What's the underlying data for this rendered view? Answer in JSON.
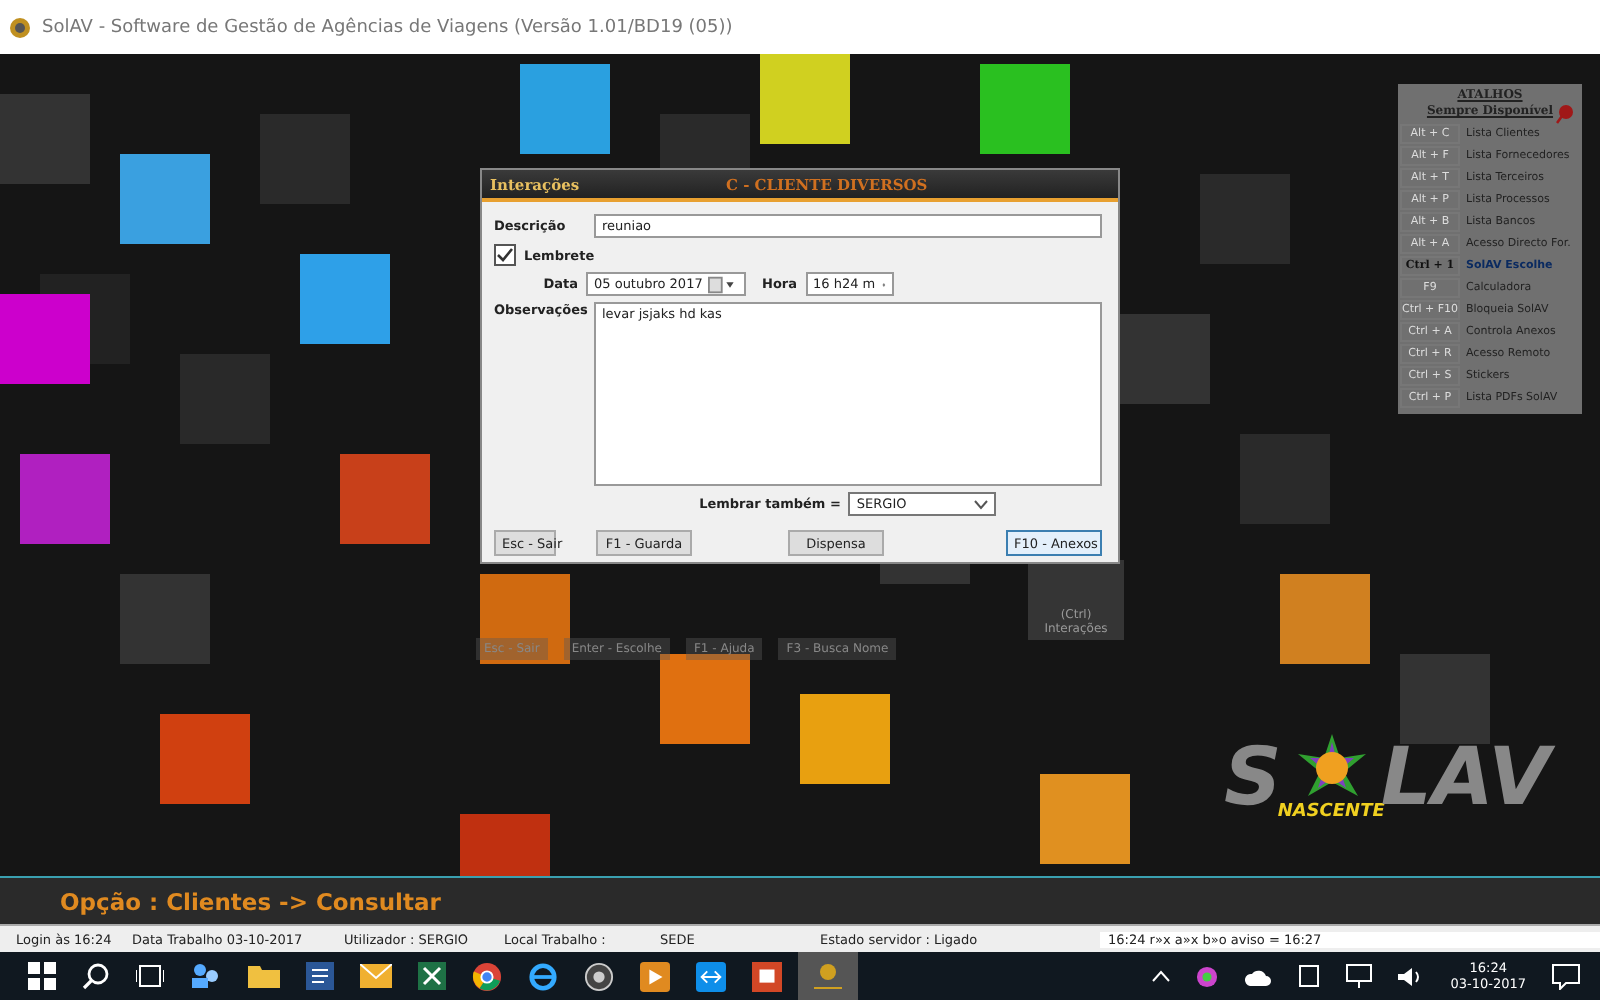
{
  "window": {
    "title": "SolAV - Software de Gestão de Agências de Viagens (Versão 1.01/BD19 (05))"
  },
  "dialog": {
    "tab": "Interações",
    "client": "C - CLIENTE DIVERSOS",
    "description": {
      "label": "Descrição",
      "value": "reuniao"
    },
    "reminder": {
      "label": "Lembrete",
      "checked": true
    },
    "date": {
      "label": "Data",
      "value": "05  outubro  2017"
    },
    "time": {
      "label": "Hora",
      "value": "16 h24 m"
    },
    "notes": {
      "label": "Observações",
      "value": "levar jsjaks hd kas"
    },
    "remind_also": {
      "label": "Lembrar também =",
      "value": "SERGIO"
    },
    "buttons": [
      {
        "label": "Esc - Sair",
        "selected": false
      },
      {
        "label": "F1 - Guarda",
        "selected": false
      },
      {
        "label": "Dispensa",
        "selected": false
      },
      {
        "label": "F10 - Anexos",
        "selected": true
      }
    ]
  },
  "shortcuts": {
    "title": "ATALHOS",
    "subtitle": "Sempre Disponível",
    "items": [
      {
        "key": "Alt + C",
        "action": "Lista Clientes",
        "kind": "normal"
      },
      {
        "key": "Alt + F",
        "action": "Lista Fornecedores",
        "kind": "normal"
      },
      {
        "key": "Alt + T",
        "action": "Lista Terceiros",
        "kind": "normal"
      },
      {
        "key": "Alt + P",
        "action": "Lista Processos",
        "kind": "normal"
      },
      {
        "key": "Alt + B",
        "action": "Lista Bancos",
        "kind": "normal"
      },
      {
        "key": "Alt + A",
        "action": "Acesso Directo For.",
        "kind": "normal"
      },
      {
        "key": "Ctrl + 1",
        "action": "SolAV Escolhe",
        "kind": "highlight"
      },
      {
        "key": "F9",
        "action": "Calculadora",
        "kind": "normal"
      },
      {
        "key": "Ctrl + F10",
        "action": "Bloqueia SolAV",
        "kind": "normal"
      },
      {
        "key": "Ctrl + A",
        "action": "Controla Anexos",
        "kind": "normal"
      },
      {
        "key": "Ctrl + R",
        "action": "Acesso Remoto",
        "kind": "normal"
      },
      {
        "key": "Ctrl + S",
        "action": "Stickers",
        "kind": "normal"
      },
      {
        "key": "Ctrl + P",
        "action": "Lista PDFs SolAV",
        "kind": "normal"
      }
    ]
  },
  "behind": {
    "ctrl_hint": "(Ctrl)",
    "ctrl_label": "Interações",
    "buttons": [
      "Esc - Sair",
      "Enter - Escolhe",
      "F1 - Ajuda",
      "F3 - Busca Nome"
    ]
  },
  "logo": {
    "left": "S",
    "right": "LAV",
    "brand": "NASCENTE"
  },
  "option_bar": "Opção : Clientes -> Consultar",
  "status_bar": [
    "Login às 16:24",
    "Data Trabalho 03-10-2017",
    "Utilizador : SERGIO",
    "Local Trabalho :",
    "SEDE",
    "Estado servidor : Ligado",
    "16:24 r»x a»x b»o aviso = 16:27"
  ],
  "taskbar": {
    "time": "16:24",
    "date": "03-10-2017"
  }
}
